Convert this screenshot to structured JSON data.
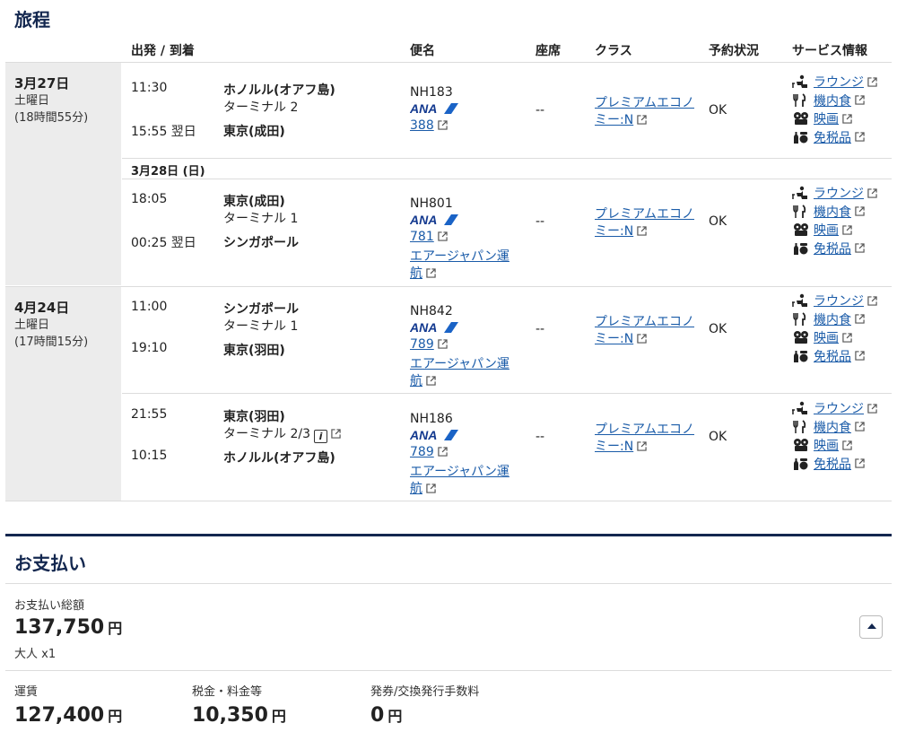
{
  "itinerary": {
    "title": "旅程",
    "headers": {
      "depart_arrive": "出発 / 到着",
      "flight": "便名",
      "seat": "座席",
      "class": "クラス",
      "status": "予約状況",
      "services": "サービス情報"
    },
    "days": [
      {
        "date": "3月27日",
        "weekday": "土曜日",
        "duration": "(18時間55分)"
      },
      {
        "date": "4月24日",
        "weekday": "土曜日",
        "duration": "(17時間15分)"
      }
    ],
    "sub_date": "3月28日 (日)",
    "flights": [
      {
        "dep_time": "11:30",
        "dep_city": "ホノルル(オアフ島)",
        "dep_terminal": "ターミナル 2",
        "arr_time": "15:55 翌日",
        "arr_city": "東京(成田)",
        "arr_terminal": "",
        "flight_no": "NH183",
        "airline_logo": "ANA",
        "aircraft": "388",
        "operator_line1": "",
        "operator_line2": "",
        "seat": "--",
        "class_line1": "プレミアムエコノ",
        "class_line2": "ミー:N",
        "status": "OK"
      },
      {
        "dep_time": "18:05",
        "dep_city": "東京(成田)",
        "dep_terminal": "ターミナル 1",
        "arr_time": "00:25 翌日",
        "arr_city": "シンガポール",
        "arr_terminal": "",
        "flight_no": "NH801",
        "airline_logo": "ANA",
        "aircraft": "781",
        "operator_line1": "エアージャパン運",
        "operator_line2": "航",
        "seat": "--",
        "class_line1": "プレミアムエコノ",
        "class_line2": "ミー:N",
        "status": "OK"
      },
      {
        "dep_time": "11:00",
        "dep_city": "シンガポール",
        "dep_terminal": "ターミナル 1",
        "arr_time": "19:10",
        "arr_city": "東京(羽田)",
        "arr_terminal": "",
        "flight_no": "NH842",
        "airline_logo": "ANA",
        "aircraft": "789",
        "operator_line1": "エアージャパン運",
        "operator_line2": "航",
        "seat": "--",
        "class_line1": "プレミアムエコノ",
        "class_line2": "ミー:N",
        "status": "OK"
      },
      {
        "dep_time": "21:55",
        "dep_city": "東京(羽田)",
        "dep_terminal": "ターミナル 2/3",
        "arr_time": "10:15",
        "arr_city": "ホノルル(オアフ島)",
        "arr_terminal": "",
        "flight_no": "NH186",
        "airline_logo": "ANA",
        "aircraft": "789",
        "operator_line1": "エアージャパン運",
        "operator_line2": "航",
        "seat": "--",
        "class_line1": "プレミアムエコノ",
        "class_line2": "ミー:N",
        "status": "OK"
      }
    ],
    "services": [
      {
        "label": "ラウンジ",
        "icon": "lounge-icon"
      },
      {
        "label": "機内食",
        "icon": "meal-icon"
      },
      {
        "label": "映画",
        "icon": "movie-icon"
      },
      {
        "label": "免税品",
        "icon": "dutyfree-icon"
      }
    ]
  },
  "payment": {
    "title": "お支払い",
    "total_label": "お支払い総額",
    "total_amount": "137,750",
    "currency": "円",
    "passengers": "大人 x1",
    "breakdown": [
      {
        "label": "運賃",
        "amount": "127,400"
      },
      {
        "label": "税金・料金等",
        "amount": "10,350"
      },
      {
        "label": "発券/交換発行手数料",
        "amount": "0"
      }
    ]
  },
  "colors": {
    "navy": "#13274f",
    "link": "#1a5ba8",
    "day_bg": "#ececec"
  }
}
